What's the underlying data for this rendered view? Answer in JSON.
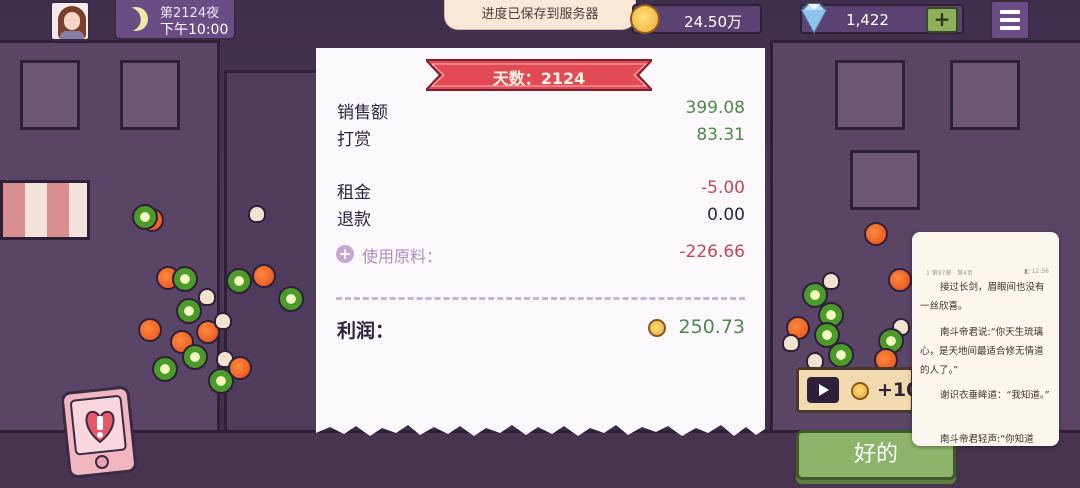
{
  "header": {
    "day_label": "第2124夜",
    "time_label": "下午10:00",
    "toast": "进度已保存到服务器",
    "coins": "24.50万",
    "gems": "1,422",
    "plus_label": "+"
  },
  "receipt": {
    "banner": "天数：2124",
    "rows": [
      {
        "label": "销售额",
        "value": "399.08",
        "tone": "green"
      },
      {
        "label": "打赏",
        "value": "83.31",
        "tone": "green"
      },
      {
        "label": "租金",
        "value": "-5.00",
        "tone": "red"
      },
      {
        "label": "退款",
        "value": "0.00",
        "tone": "dark"
      }
    ],
    "material_label": "使用原料：",
    "material_value": "-226.66",
    "profit_label": "利润：",
    "profit_value": "250.73"
  },
  "ad_button": {
    "label": "+10"
  },
  "ok_button": {
    "label": "好的"
  },
  "reader": {
    "status_left": "1 第97章 · 第4页",
    "status_right": "◧ 12:56",
    "paragraphs": [
      "接过长剑，眉眼间也没有一丝欣喜。",
      "南斗帝君说:“你天生琉璃心，是天地间最适合修无情道的人了。”",
      "谢识衣垂眸道：“我知道。”",
      "南斗帝君轻声:“你知道"
    ]
  },
  "colors": {
    "receipt_bg": "#fbf8fb",
    "banner_red": "#e24a55",
    "income_green": "#4f8a4a",
    "expense_red": "#c4465a",
    "ok_green": "#8cb46a"
  }
}
